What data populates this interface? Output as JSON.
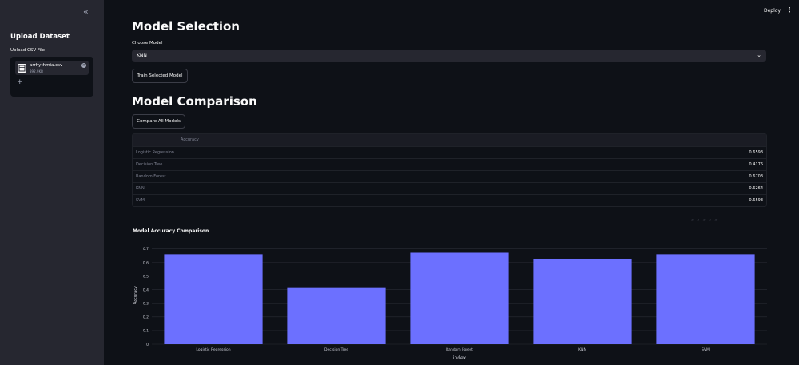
{
  "sidebar": {
    "collapse_icon": "double-chevron-left-icon",
    "title": "Upload Dataset",
    "upload_label": "Upload CSV File",
    "file": {
      "name": "arrhythmia.csv",
      "size": "392.9KB"
    }
  },
  "header": {
    "deploy_label": "Deploy"
  },
  "model_selection": {
    "heading": "Model Selection",
    "select_label": "Choose Model",
    "selected_value": "KNN",
    "train_button": "Train Selected Model"
  },
  "comparison": {
    "heading": "Model Comparison",
    "compare_button": "Compare All Models",
    "table": {
      "column": "Accuracy",
      "rows": [
        {
          "index": "Logistic Regression",
          "accuracy": "0.6593"
        },
        {
          "index": "Decision Tree",
          "accuracy": "0.4176"
        },
        {
          "index": "Random Forest",
          "accuracy": "0.6703"
        },
        {
          "index": "KNN",
          "accuracy": "0.6264"
        },
        {
          "index": "SVM",
          "accuracy": "0.6593"
        }
      ]
    }
  },
  "chart_data": {
    "type": "bar",
    "title": "Model Accuracy Comparison",
    "xlabel": "index",
    "ylabel": "Accuracy",
    "categories": [
      "Logistic Regression",
      "Decision Tree",
      "Random Forest",
      "KNN",
      "SVM"
    ],
    "values": [
      0.6593,
      0.4176,
      0.6703,
      0.6264,
      0.6593
    ],
    "yticks": [
      "0",
      "0.1",
      "0.2",
      "0.3",
      "0.4",
      "0.5",
      "0.6",
      "0.7"
    ],
    "ylim": [
      0,
      0.72
    ],
    "bar_color": "#6c70ff",
    "grid": true
  }
}
